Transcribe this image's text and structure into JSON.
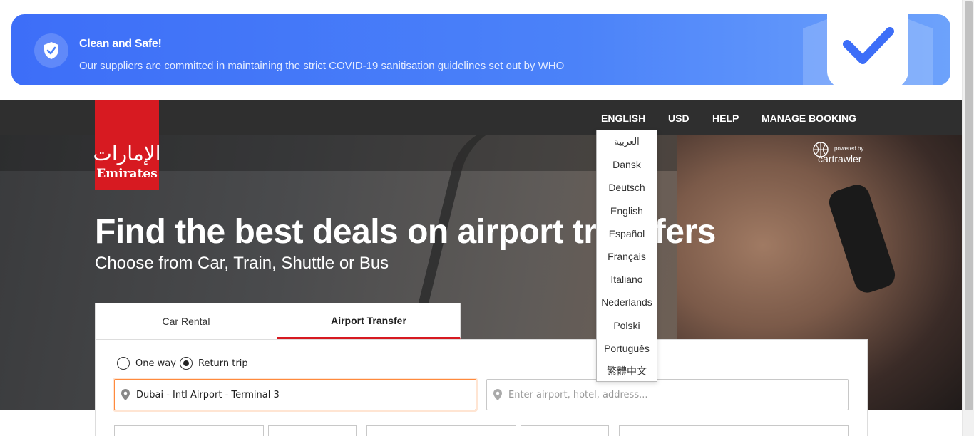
{
  "banner": {
    "title": "Clean and Safe!",
    "subtitle": "Our suppliers are committed in maintaining the strict COVID-19 sanitisation guidelines set out by WHO",
    "icon": "shield-check-icon"
  },
  "nav": {
    "language": "ENGLISH",
    "currency": "USD",
    "help": "HELP",
    "manage_booking": "MANAGE BOOKING"
  },
  "logo": {
    "script": "ﺍﻹﻣﺎﺭﺍﺕ",
    "word": "Emirates"
  },
  "partner": {
    "powered_by": "powered by",
    "name": "cartrawler"
  },
  "hero": {
    "headline": "Find the best deals on airport transfers",
    "subhead": "Choose from Car, Train, Shuttle or Bus"
  },
  "tabs": [
    {
      "label": "Car Rental",
      "active": false
    },
    {
      "label": "Airport Transfer",
      "active": true
    }
  ],
  "trip_type": {
    "one_way": "One way",
    "return_trip": "Return trip",
    "selected": "return_trip"
  },
  "search": {
    "pickup_value": "Dubai - Intl Airport - Terminal 3",
    "dropoff_placeholder": "Enter airport, hotel, address..."
  },
  "languages": [
    "العربية",
    "Dansk",
    "Deutsch",
    "English",
    "Español",
    "Français",
    "Italiano",
    "Nederlands",
    "Polski",
    "Português",
    "繁體中文"
  ],
  "colors": {
    "brand_red": "#d71a21",
    "banner_blue": "#3d6ef8",
    "nav_dark": "#2f2f2f",
    "focus_orange": "#ff8a3d"
  }
}
